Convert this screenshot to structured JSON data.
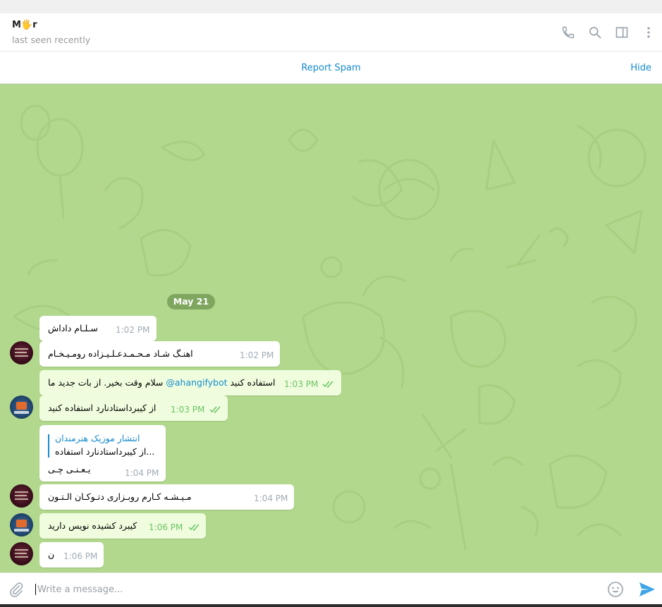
{
  "header": {
    "peer_name": "M🖐r",
    "status": "last seen recently",
    "icons": [
      "phone-icon",
      "search-icon",
      "sidebar-toggle-icon",
      "more-vertical-icon"
    ]
  },
  "spam_bar": {
    "report_label": "Report Spam",
    "hide_label": "Hide"
  },
  "chat": {
    "background_color": "#b2d88d",
    "date_label": "May 21",
    "messages": [
      {
        "direction": "in",
        "text": "سـلـام داداش",
        "time": "1:02 PM"
      },
      {
        "direction": "in",
        "text": "اهنـگ شـاد مـحـمـدعـلـیـزاده رومـیـخـام",
        "time": "1:02 PM"
      },
      {
        "direction": "out",
        "text_prefix": "سلام وقت بخیر. از بات جدید ما ",
        "link": "@ahangifybot",
        "text_suffix": " استفاده کنید",
        "time": "1:03 PM"
      },
      {
        "direction": "out",
        "text": "از کیبرداستادنارد استفاده کنید",
        "time": "1:03 PM"
      },
      {
        "direction": "in",
        "reply_to_name": "انتشار موزیک هنرمندان",
        "reply_to_text": "از کیبرداستادنارد استفاده...",
        "text": "یـعـنـی چـی",
        "time": "1:04 PM"
      },
      {
        "direction": "in",
        "text": "مـیـشـه کـارم روبـزاری دتـوکـان الـتـون",
        "time": "1:04 PM"
      },
      {
        "direction": "out",
        "text": "کیبرد کشیده نویس دارید",
        "time": "1:06 PM"
      },
      {
        "direction": "in",
        "text": "ن",
        "time": "1:06 PM"
      }
    ]
  },
  "composer": {
    "placeholder": "Write a message...",
    "value": ""
  },
  "colors": {
    "accent": "#168acd",
    "outgoing_bubble": "#effdde",
    "outgoing_time": "#6cc264",
    "incoming_time": "#a0acb6"
  }
}
